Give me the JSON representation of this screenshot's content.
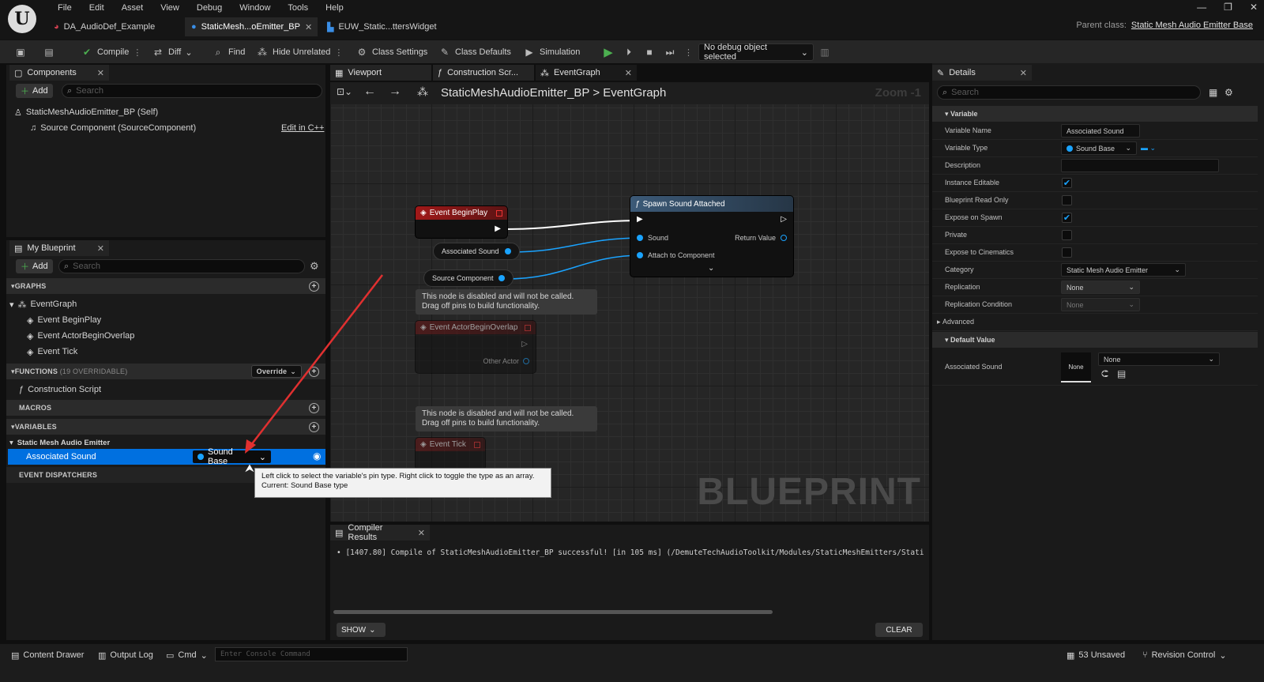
{
  "menu": [
    "File",
    "Edit",
    "Asset",
    "View",
    "Debug",
    "Window",
    "Tools",
    "Help"
  ],
  "doc_tabs": [
    {
      "label": "DA_AudioDef_Example",
      "icon": "data-asset-icon",
      "active": false
    },
    {
      "label": "StaticMesh...oEmitter_BP",
      "icon": "blueprint-icon",
      "active": true
    },
    {
      "label": "EUW_Static...ttersWidget",
      "icon": "widget-icon",
      "active": false
    }
  ],
  "parent_class": {
    "label": "Parent class:",
    "value": "Static Mesh Audio Emitter Base"
  },
  "toolbar": {
    "compile": "Compile",
    "diff": "Diff",
    "find": "Find",
    "hide_unrelated": "Hide Unrelated",
    "class_settings": "Class Settings",
    "class_defaults": "Class Defaults",
    "simulation": "Simulation",
    "debug_object": "No debug object selected"
  },
  "components": {
    "tab": "Components",
    "add": "Add",
    "search_placeholder": "Search",
    "self": "StaticMeshAudioEmitter_BP (Self)",
    "source": "Source Component (SourceComponent)",
    "edit_cpp": "Edit in C++"
  },
  "my_blueprint": {
    "tab": "My Blueprint",
    "add": "Add",
    "search_placeholder": "Search",
    "graphs_header": "GRAPHS",
    "event_graph": "EventGraph",
    "events": [
      "Event BeginPlay",
      "Event ActorBeginOverlap",
      "Event Tick"
    ],
    "functions_header": "FUNCTIONS",
    "functions_count": "(19 OVERRIDABLE)",
    "override": "Override",
    "construction_script": "Construction Script",
    "macros_header": "MACROS",
    "variables_header": "VARIABLES",
    "var_category": "Static Mesh Audio Emitter",
    "var_name": "Associated Sound",
    "var_type": "Sound Base",
    "dispatchers_header": "EVENT DISPATCHERS"
  },
  "tooltip": {
    "line1": "Left click to select the variable's pin type. Right click to toggle the type as an array.",
    "line2": "Current: Sound Base type"
  },
  "graph_tabs": [
    "Viewport",
    "Construction Scr...",
    "EventGraph"
  ],
  "graph": {
    "breadcrumb_bp": "StaticMeshAudioEmitter_BP",
    "breadcrumb_sep": ">",
    "breadcrumb_graph": "EventGraph",
    "zoom": "Zoom -1",
    "begin_play": "Event BeginPlay",
    "associated_sound": "Associated Sound",
    "source_component": "Source Component",
    "spawn_title": "Spawn Sound Attached",
    "pin_sound": "Sound",
    "pin_return": "Return Value",
    "pin_attach": "Attach to Component",
    "disabled_line1": "This node is disabled and will not be called.",
    "disabled_line2": "Drag off pins to build functionality.",
    "overlap": "Event ActorBeginOverlap",
    "other_actor": "Other Actor",
    "tick": "Event Tick",
    "watermark": "BLUEPRINT"
  },
  "compiler": {
    "tab": "Compiler Results",
    "message": "[1407.80] Compile of StaticMeshAudioEmitter_BP successful! [in 105 ms] (/DemuteTechAudioToolkit/Modules/StaticMeshEmitters/Stati",
    "show": "SHOW",
    "clear": "CLEAR"
  },
  "details": {
    "tab": "Details",
    "search_placeholder": "Search",
    "variable_header": "Variable",
    "rows": {
      "name": {
        "label": "Variable Name",
        "value": "Associated Sound"
      },
      "type": {
        "label": "Variable Type",
        "value": "Sound Base"
      },
      "description": {
        "label": "Description"
      },
      "instance_editable": {
        "label": "Instance Editable",
        "checked": true
      },
      "bp_read_only": {
        "label": "Blueprint Read Only",
        "checked": false
      },
      "expose_spawn": {
        "label": "Expose on Spawn",
        "checked": true
      },
      "private": {
        "label": "Private",
        "checked": false
      },
      "expose_cinematics": {
        "label": "Expose to Cinematics",
        "checked": false
      },
      "category": {
        "label": "Category",
        "value": "Static Mesh Audio Emitter"
      },
      "replication": {
        "label": "Replication",
        "value": "None"
      },
      "replication_condition": {
        "label": "Replication Condition",
        "value": "None"
      }
    },
    "advanced": "Advanced",
    "default_header": "Default Value",
    "default_label": "Associated Sound",
    "thumb": "None",
    "default_value": "None"
  },
  "status": {
    "content_drawer": "Content Drawer",
    "output_log": "Output Log",
    "cmd": "Cmd",
    "console_placeholder": "Enter Console Command",
    "unsaved": "53 Unsaved",
    "revision": "Revision Control"
  },
  "colors": {
    "accent": "#0070e0",
    "pin_blue": "#1aa3ff",
    "event_red": "#a01818",
    "func_blue": "#3c5a78"
  }
}
